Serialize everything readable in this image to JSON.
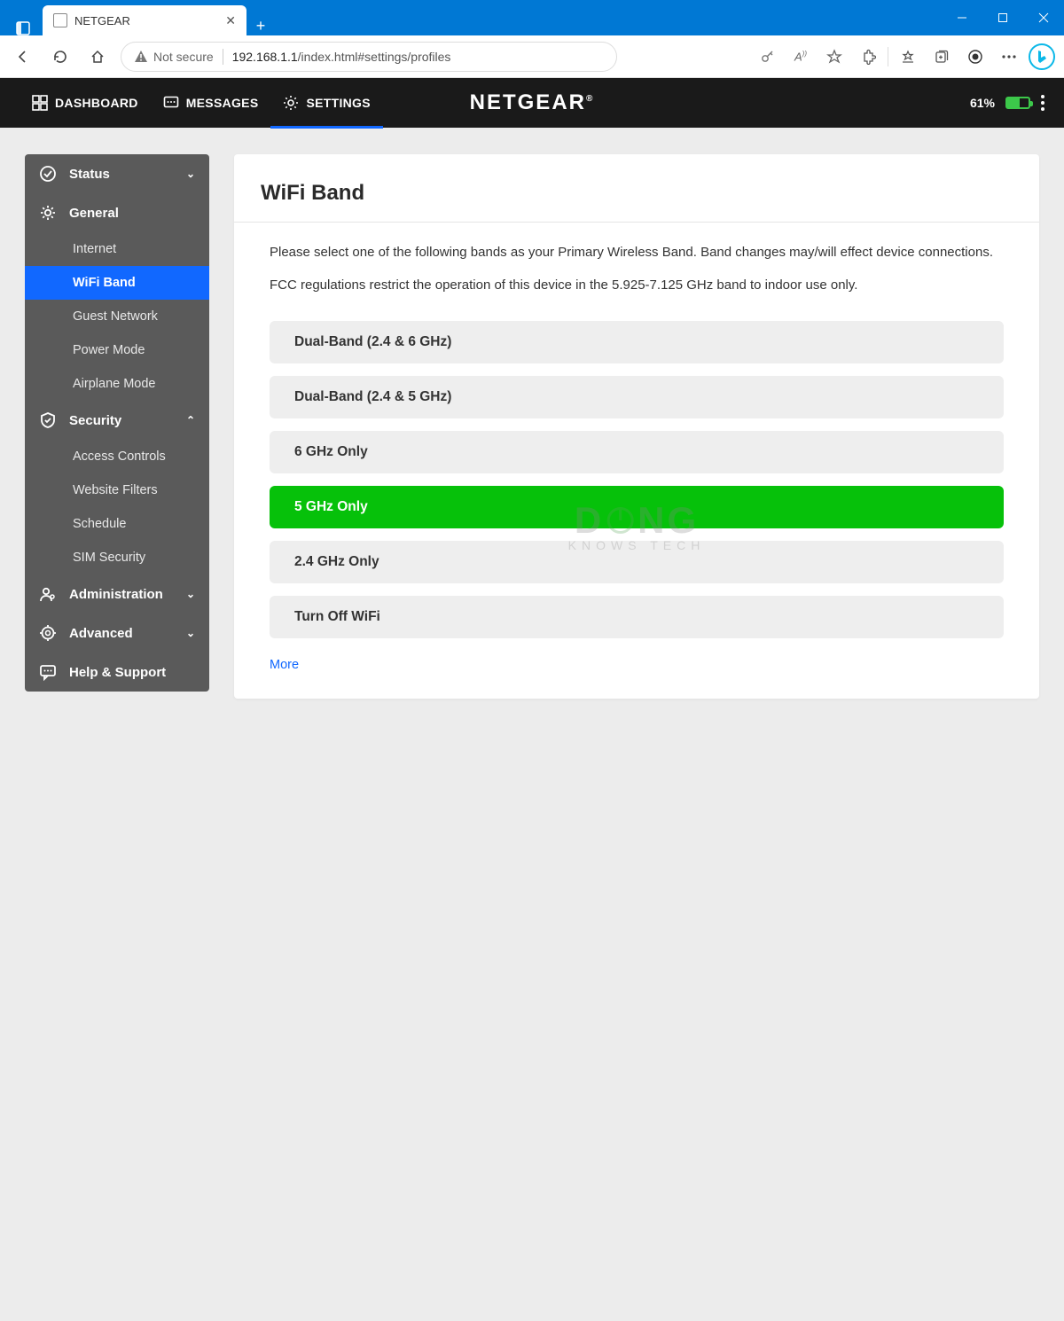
{
  "browser": {
    "tab_title": "NETGEAR",
    "security_label": "Not secure",
    "url_host": "192.168.1.1",
    "url_path": "/index.html#settings/profiles"
  },
  "header": {
    "nav": {
      "dashboard": "DASHBOARD",
      "messages": "MESSAGES",
      "settings": "SETTINGS"
    },
    "brand": "NETGEAR",
    "battery_percent": "61%"
  },
  "sidebar": {
    "status": {
      "label": "Status"
    },
    "general": {
      "label": "General",
      "items": {
        "internet": "Internet",
        "wifi_band": "WiFi Band",
        "guest_network": "Guest Network",
        "power_mode": "Power Mode",
        "airplane_mode": "Airplane Mode"
      }
    },
    "security": {
      "label": "Security",
      "items": {
        "access_controls": "Access Controls",
        "website_filters": "Website Filters",
        "schedule": "Schedule",
        "sim_security": "SIM Security"
      }
    },
    "administration": {
      "label": "Administration"
    },
    "advanced": {
      "label": "Advanced"
    },
    "help": {
      "label": "Help & Support"
    }
  },
  "main": {
    "title": "WiFi Band",
    "intro1": "Please select one of the following bands as your Primary Wireless Band. Band changes may/will effect device connections.",
    "intro2": "FCC regulations restrict the operation of this device in the 5.925-7.125 GHz band to indoor use only.",
    "options": {
      "dual_246": "Dual-Band (2.4 & 6 GHz)",
      "dual_245": "Dual-Band (2.4 & 5 GHz)",
      "only6": "6 GHz Only",
      "only5": "5 GHz Only",
      "only24": "2.4 GHz Only",
      "off": "Turn Off WiFi"
    },
    "selected": "only5",
    "more": "More"
  },
  "watermark": {
    "main": "DONG",
    "sub": "KNOWS TECH"
  }
}
